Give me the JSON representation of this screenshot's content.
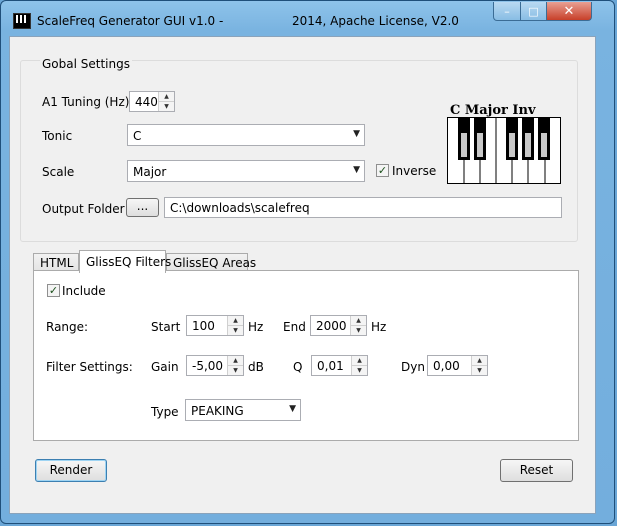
{
  "window": {
    "title": "ScaleFreq Generator GUI v1.0 -",
    "license": "2014, Apache License, V2.0",
    "minimize": "–",
    "maximize": "□",
    "close": "✕"
  },
  "settings": {
    "group_title": "Gobal Settings",
    "tuning": {
      "label": "A1 Tuning (Hz)",
      "value": "440"
    },
    "tonic": {
      "label": "Tonic",
      "value": "C"
    },
    "scale": {
      "label": "Scale",
      "value": "Major"
    },
    "inverse": {
      "label": "Inverse",
      "checked": true
    },
    "output": {
      "label": "Output Folder",
      "browse_label": "...",
      "value": "C:\\downloads\\scalefreq"
    }
  },
  "piano": {
    "title": "C Major Inv",
    "white_keys": 7,
    "black_keys_highlighted": true
  },
  "tabs": [
    {
      "label": "HTML",
      "active": false
    },
    {
      "label": "GlissEQ Filters",
      "active": true
    },
    {
      "label": "GlissEQ Areas",
      "active": false
    }
  ],
  "filters": {
    "include": {
      "label": "Include",
      "checked": true
    },
    "range": {
      "label": "Range:",
      "start_label": "Start",
      "start_value": "100",
      "start_unit": "Hz",
      "end_label": "End",
      "end_value": "2000",
      "end_unit": "Hz"
    },
    "filter_settings": {
      "label": "Filter Settings:",
      "gain_label": "Gain",
      "gain_value": "-5,00",
      "gain_unit": "dB",
      "q_label": "Q",
      "q_value": "0,01",
      "dyn_label": "Dyn",
      "dyn_value": "0,00"
    },
    "type": {
      "label": "Type",
      "value": "PEAKING"
    }
  },
  "actions": {
    "render_label": "Render",
    "reset_label": "Reset"
  }
}
